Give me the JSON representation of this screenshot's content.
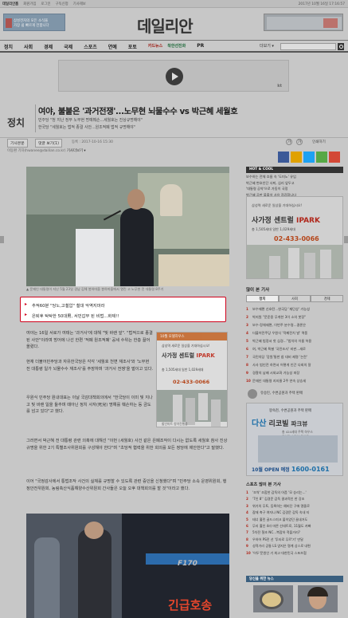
{
  "topbar": {
    "site_label": "데일리안홈",
    "links": [
      "회원가입",
      "로그인",
      "구독신청",
      "기사제보"
    ],
    "date": "2017년 10월 16일 17:16:57"
  },
  "header": {
    "logo": "데일리안",
    "promo_left": [
      "삼성전자의 모든 소식을",
      "가장 쉽 빠르게 전합니다"
    ]
  },
  "nav": {
    "items": [
      "정치",
      "사회",
      "경제",
      "국제",
      "스포츠",
      "연예",
      "포토"
    ],
    "special": "카드뉴스",
    "special2": "착한선진화",
    "pr": "PR",
    "more": "더보기 ▾"
  },
  "ad_banner": {
    "brand": "kt"
  },
  "article": {
    "section": "정치",
    "headline": "여야, 불붙은 '과거전쟁'...노무현 뇌물수수 vs 박근혜 세월호",
    "subheads": [
      "민주당 \"청 지난 정부 노무현 명예훼손...세월호는 진상규명해야\"",
      "한국당 \"세월호는 법적 종결 사안...원조적폐 법적 규명해야\""
    ],
    "meta_tabs": [
      "기사본문",
      "댓글 보기(1)"
    ],
    "date": "등록 : 2017-10-16 15:30",
    "tools": [
      "가",
      "가",
      "인쇄하기"
    ],
    "reporter": "이동환 기자(hwanee@dailian.co.kr)",
    "reporter_more": "기사더보기 ▾",
    "caption": "▲ 문재인 대통령이 지난 5월 23일 경남 김해 봉하마을 봉하마을에서 열린 고 노무현 전 대통령 8주기",
    "related": [
      "추적60분 \"당노,고철압\" 철대 악역지마라",
      "은퇴후 탁탁한 50대男, 서민갑부 된 비법...화제!!"
    ],
    "para1": "여야는 16일 서로가 여태는 '과거사'에 대해 \"빛 바랜 앞\". \"법적으로 종결된 사안\"이라며 방어에 나선 한편 '적폐 원조적폐' 공세 수위는 한층 끌어올렸다.",
    "para2": "현재 더불어민주당과 자유한국당은 각각 '세월호 천변 재조사'와 '노무현 전 대통령 일가 뇌물수수 재조사'를 주장하며 '과거사 전쟁'을 벌이고 있다.",
    "para3": "우원식 민주당 원내대표는 이날 국감대책회의에서 \"한국당이 이미 빛 지나고 빛 바랜 일을 들추며 때아닌 정치 사자(死兒) 명예를 훼손하는 등 금도를 넘고 있다\"고 했다.",
    "para4": "그러면서 박근혜 전 대통령 관련 의혹에 대해선 \"이번 (세월호) 사건 같은 은폐조작이 다시는 없도록 세월호 참사 진상규명을 위한 2기 특별조사위원회를 구성해야 한다\"며 \"초당적 협력을 위한 회의를 모든 정당에 제안한다\"고 말했다.",
    "para5": "이어 \"국정감사에서 통법조작 사건의 실체를 규명할 수 있도록 관련 증인을 신청했다\"며 \"민주당 소속 운영위원회, 행정안전위원회, 농림축산식품해양수산위원회 간사들은 오늘 오후 대책회의를 할 것\"이라고 했다.",
    "bus_number": "F170",
    "bus_sign": "긴급호송"
  },
  "inline_ad": {
    "top": "10월 모델하우스",
    "line1": "삼성역 새로운 일상을 기대하십시오!",
    "title_a": "사가정 센트럴",
    "title_b": "IPARK",
    "line2": "총 1,505세대 일반 1,029세대",
    "phone": "02-433-0066",
    "foot": "할인마트 청약진행중"
  },
  "sidebar": {
    "hot_cool": "HOT & COOL",
    "hot_list": [
      "보수하는 전체 흐름 속 '도미노' 유입",
      "박근혜 변호인단 사퇴, 심리 앞두고",
      "'대통령 공약'으로 가동이 국정",
      "박근혜 공판 불출석 사유 점검합니다"
    ],
    "ad_line1": "삼성역 새로운 일상을 기대하십시오!",
    "ad_title_a": "사가정 센트럴",
    "ad_title_b": "IPARK",
    "ad_line2": "총 1,505세대 일반 1,029세대",
    "ad_phone": "02-433-0066",
    "popular_title": "많이 본 기사",
    "popular_tabs": [
      "정치",
      "사회",
      "경제"
    ],
    "popular": [
      "보수재편 신호탄...완국당 '재단상' 가능성",
      "박지원 \"문준용 무게한 3이 소의 봇장\"",
      "보수·정체재편, 이번주 분수령...결론은",
      "더블어민주당 우원식 '적폐전치 발' 역풍",
      "박근혜 법정서 첫 심경...\"법치의 이름 허용",
      "여, 박근혜 특별 '국민조사' 비판...새로",
      "국민의당 '강원'통한 참 대비 제명 '논란'",
      "사사 범인전 하면서 어떻게 인간 다회의 잘",
      "경찰의 남배 시외교화 가능성 파장",
      "문재인 대통령 지지율 2주 연속 상승세",
      "유세 '외교'에 대해 건드리기...한지 제출"
    ],
    "sponsor": "유승민, 수변공원과 주택 판매",
    "ad2_line1": "왕숙천, 수변공원과 주택 판매",
    "ad2_brand_a": "다산",
    "ad2_brand_b": "리코빌",
    "ad2_brand_c": "파크뷰",
    "ad2_sm1": "총 424세대 주택 하우스",
    "ad2_sm2": "중앙관리 직영 운영중",
    "ad2_foot_a": "10월 OPEN 예정",
    "ad2_foot_b": "1600-0161",
    "sports_title": "스포츠 많이 본 기사",
    "sports": [
      "'조싹' 조합한 감독의 아픔 '모 승리는...'",
      "'7인 8'' 김경문 감독 결과적인 한 강조",
      "위기의 무토, 등록하는 예비단 구애 명졸로",
      "잠재 축구 여자나 NC 김경문 감독 속내 티",
      "테너 홀린 골드스미크 불이었던 꼴내거도",
      "무리 홀인 4라 마른 선데트로, 11월도 카빠",
      "5차전 철초 NC...복잡하 적플거리?",
      "우하어 PS전 선 '투타로 무르'기' 만달",
      "성적가리 공통 LS 양지은 명계 상스로 내편",
      "'어두'문원인 기 최고 대한민국 스포츠협"
    ],
    "recommend": "당신을 위한 뉴스"
  },
  "colors": {
    "accent": "#d0021b",
    "share": [
      "#3b5998",
      "#e0a100",
      "#1da1f2",
      "#56a845",
      "#6aa83a",
      "#d34836"
    ]
  }
}
